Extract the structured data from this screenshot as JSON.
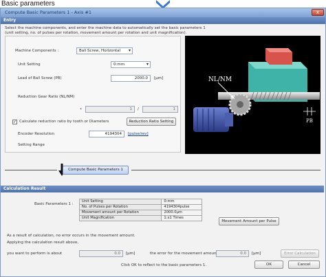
{
  "page_caption": "Basic parameters",
  "window": {
    "title": "Compute Basic Parameters 1 - Axis #1",
    "close_label": "x"
  },
  "entry": {
    "header": "Entry",
    "intro_line1": "Select the machine components, and enter the machine data to automatically set the basic parameters 1",
    "intro_line2": "(unit setting, no. of pulses per rotation, movement amount per rotation and unit magnification).",
    "machine_components_label": "Machine Components :",
    "machine_components_value": "Ball Screw, Horizontal",
    "unit_setting_label": "Unit Setting",
    "unit_setting_value": "0:mm",
    "lead_label": "Lead of Ball Screw (PB)",
    "lead_value": "2000.0",
    "lead_unit": "[µm]",
    "reduction_label": "Reduction Gear Ratio (NL/NM)",
    "reduction_numerator": "1",
    "reduction_separator": "/",
    "reduction_denominator": "1",
    "calc_checkbox_label": "Calculate reduction ratio by tooth or Diameters",
    "reduction_ratio_button": "Reduction Ratio Setting",
    "encoder_label": "Encoder Resolution",
    "encoder_value": "4194304",
    "encoder_unit_link": "[pulse/rev]",
    "setting_range_label": "Setting Range",
    "image_label_nlnm": "NL/NM",
    "image_label_pb": "PB"
  },
  "compute_button": "Compute Basic Parameters 1",
  "result": {
    "header": "Calculation Result",
    "basic_params_label": "Basic Parameters 1 :",
    "table": [
      [
        "Unit Setting",
        "0:mm"
      ],
      [
        "No. of Pulses per Rotation",
        "4194304pulse"
      ],
      [
        "Movement amount per Rotation",
        "2000.0µm"
      ],
      [
        "Unit Magnification",
        "1:x1 Times"
      ]
    ],
    "movement_button": "Movement Amount per Pulse",
    "note1": "As a result of calculation, no error occurs in the movement amount.",
    "note2": "Applying the calculation result above,",
    "perform_label": "you want to perform is about",
    "perform_value": "0.0",
    "perform_unit": "[µm]",
    "error_label": "the error for the movement amount",
    "error_value": "0.0",
    "error_unit": "[µm]",
    "error_calc_button": "Error Calculation",
    "reflect_text": "Click OK to reflect to the basic parameters 1.",
    "ok_button": "OK",
    "cancel_button": "Cancel"
  },
  "colors": {
    "section_header": "#4f72ad",
    "title_bar": "#7ea1d3",
    "image_bg": "#000000",
    "table_fill": "#e9e9e9",
    "close_button": "#c5472f"
  }
}
